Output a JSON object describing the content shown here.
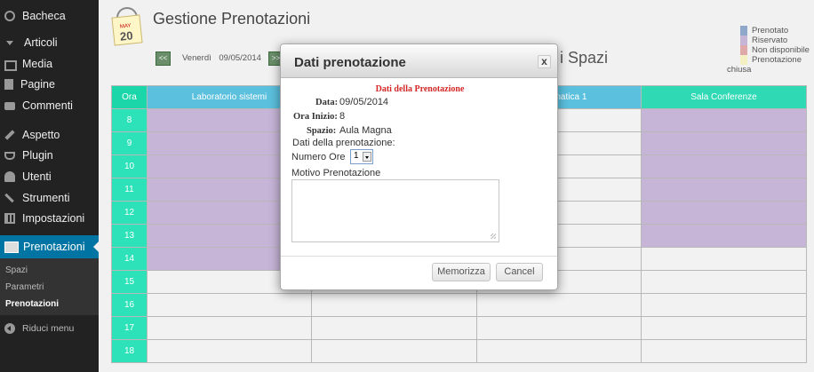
{
  "sidebar": {
    "items": [
      {
        "label": "Bacheca",
        "icon": "dashboard-dial-icon"
      },
      {
        "label": "Articoli",
        "icon": "pushpin-icon"
      },
      {
        "label": "Media",
        "icon": "media-icon"
      },
      {
        "label": "Pagine",
        "icon": "page-icon"
      },
      {
        "label": "Commenti",
        "icon": "comment-bubble-icon"
      },
      {
        "label": "Aspetto",
        "icon": "paintbrush-icon"
      },
      {
        "label": "Plugin",
        "icon": "plug-icon"
      },
      {
        "label": "Utenti",
        "icon": "user-icon"
      },
      {
        "label": "Strumenti",
        "icon": "wrench-icon"
      },
      {
        "label": "Impostazioni",
        "icon": "settings-icon"
      },
      {
        "label": "Prenotazioni",
        "icon": "book-icon"
      }
    ],
    "submenu": [
      "Spazi",
      "Parametri",
      "Prenotazioni"
    ],
    "collapse_label": "Riduci menu",
    "active_color": "#0074a2"
  },
  "header": {
    "calendar_month": "MAY",
    "calendar_day": "20",
    "title": "Gestione Prenotazioni",
    "prev_label": "<<",
    "next_label": ">>",
    "current_date": "Venerdì 09/05/2014",
    "section_title_visible": "i Spazi"
  },
  "legend": [
    {
      "label": "Prenotato",
      "color": "#8fa7c9"
    },
    {
      "label": "Riservato",
      "color": "#c7b5d8"
    },
    {
      "label": "Non disponibile",
      "color": "#e0a9a9"
    },
    {
      "label": "Prenotazione",
      "color": "#f4f0c4"
    }
  ],
  "legend_extra": "chiusa",
  "table": {
    "headers": [
      "Ora",
      "Laboratorio sistemi",
      "",
      "i Informatica 1",
      "Sala Conferenze"
    ],
    "hours": [
      "8",
      "9",
      "10",
      "11",
      "12",
      "13",
      "14",
      "15",
      "16",
      "17",
      "18"
    ],
    "reserved_color": "#c7b5d8"
  },
  "dialog": {
    "title": "Dati prenotazione",
    "close_label": "x",
    "heading": "Dati della Prenotazione",
    "date_label": "Data:",
    "date_value": "09/05/2014",
    "start_label": "Ora Inizio:",
    "start_value": "8",
    "space_label": "Spazio:",
    "space_value": "Aula Magna",
    "section_label": "Dati della prenotazione:",
    "hours_label": "Numero Ore",
    "hours_value": "1",
    "reason_label": "Motivo Prenotazione",
    "reason_value": "",
    "save_label": "Memorizza",
    "cancel_label": "Cancel"
  }
}
